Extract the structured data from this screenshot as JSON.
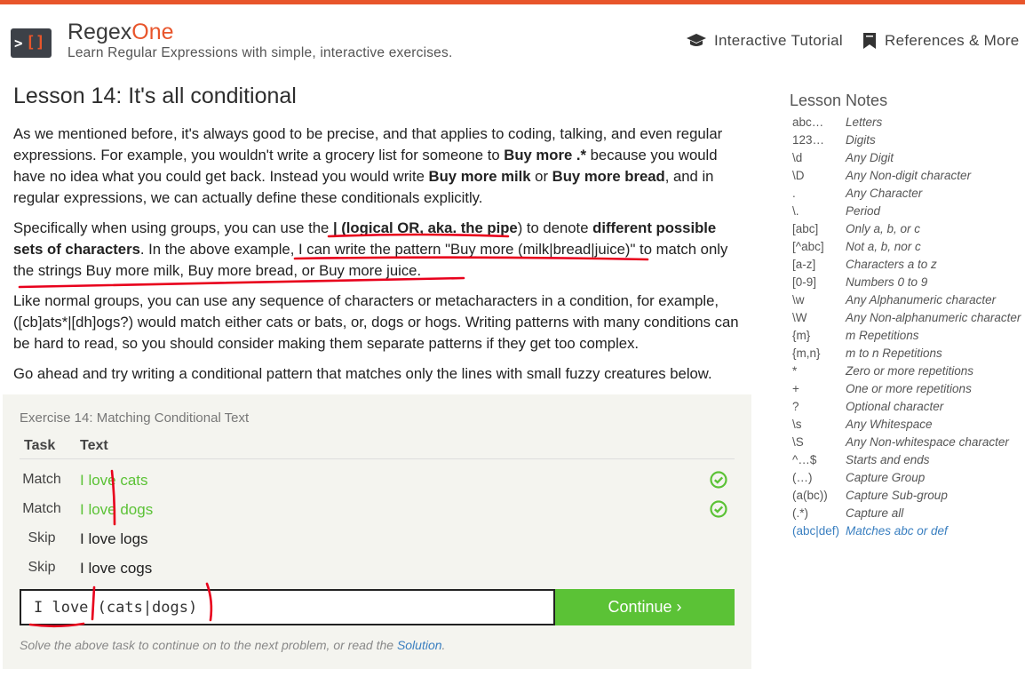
{
  "header": {
    "brand_regex": "Regex",
    "brand_one": "One",
    "tagline": "Learn Regular Expressions with simple, interactive exercises.",
    "nav": [
      {
        "label": "Interactive Tutorial",
        "icon": "graduation-cap-icon"
      },
      {
        "label": "References & More",
        "icon": "bookmark-icon"
      }
    ]
  },
  "lesson": {
    "title": "Lesson 14: It's all conditional",
    "p1": [
      "As we mentioned before, it's always good to be precise, and that applies to coding, talking, and even regular expressions. For example, you wouldn't write a grocery list for someone to ",
      "Buy more .*",
      " because you would have no idea what you could get back. Instead you would write ",
      "Buy more milk",
      " or ",
      "Buy more bread",
      ", and in regular expressions, we can actually define these conditionals explicitly."
    ],
    "p2": [
      "Specifically when using groups, you can use the ",
      "| (logical OR, aka. the pipe",
      ") to denote ",
      "different possible sets of characters",
      ". In the above example, I can write the pattern \"Buy more (milk|bread|juice)\" to match only the strings Buy more milk, Buy more bread, or Buy more juice."
    ],
    "p3": "Like normal groups, you can use any sequence of characters or metacharacters in a condition, for example, ([cb]ats*|[dh]ogs?) would match either cats or bats, or, dogs or hogs. Writing patterns with many conditions can be hard to read, so you should consider making them separate patterns if they get too complex.",
    "p4": "Go ahead and try writing a conditional pattern that matches only the lines with small fuzzy creatures below."
  },
  "exercise": {
    "title": "Exercise 14: Matching Conditional Text",
    "col_task": "Task",
    "col_text": "Text",
    "rows": [
      {
        "task": "Match",
        "text": "I love cats",
        "status": "matched"
      },
      {
        "task": "Match",
        "text": "I love dogs",
        "status": "matched"
      },
      {
        "task": "Skip",
        "text": "I love logs",
        "status": "none"
      },
      {
        "task": "Skip",
        "text": "I love cogs",
        "status": "none"
      }
    ],
    "input_value": "I love (cats|dogs)",
    "continue_label": "Continue ›",
    "hint_prefix": "Solve the above task to continue on to the next problem, or read the ",
    "hint_link": "Solution",
    "hint_suffix": "."
  },
  "notes": {
    "title": "Lesson Notes",
    "items": [
      {
        "k": "abc…",
        "d": "Letters"
      },
      {
        "k": "123…",
        "d": "Digits"
      },
      {
        "k": "\\d",
        "d": "Any Digit"
      },
      {
        "k": "\\D",
        "d": "Any Non-digit character"
      },
      {
        "k": ".",
        "d": "Any Character"
      },
      {
        "k": "\\.",
        "d": "Period"
      },
      {
        "k": "[abc]",
        "d": "Only a, b, or c"
      },
      {
        "k": "[^abc]",
        "d": "Not a, b, nor c"
      },
      {
        "k": "[a-z]",
        "d": "Characters a to z"
      },
      {
        "k": "[0-9]",
        "d": "Numbers 0 to 9"
      },
      {
        "k": "\\w",
        "d": "Any Alphanumeric character"
      },
      {
        "k": "\\W",
        "d": "Any Non-alphanumeric character"
      },
      {
        "k": "{m}",
        "d": "m Repetitions"
      },
      {
        "k": "{m,n}",
        "d": "m to n Repetitions"
      },
      {
        "k": "*",
        "d": "Zero or more repetitions"
      },
      {
        "k": "+",
        "d": "One or more repetitions"
      },
      {
        "k": "?",
        "d": "Optional character"
      },
      {
        "k": "\\s",
        "d": "Any Whitespace"
      },
      {
        "k": "\\S",
        "d": "Any Non-whitespace character"
      },
      {
        "k": "^…$",
        "d": "Starts and ends"
      },
      {
        "k": "(…)",
        "d": "Capture Group"
      },
      {
        "k": "(a(bc))",
        "d": "Capture Sub-group"
      },
      {
        "k": "(.*)",
        "d": "Capture all"
      },
      {
        "k": "(abc|def)",
        "d": "Matches abc or def"
      }
    ]
  },
  "colors": {
    "accent": "#e8552b",
    "matched_text": "#5bc236",
    "continue_bg": "#5bc236",
    "link": "#3a7fc0",
    "annotation": "#e8001c"
  }
}
